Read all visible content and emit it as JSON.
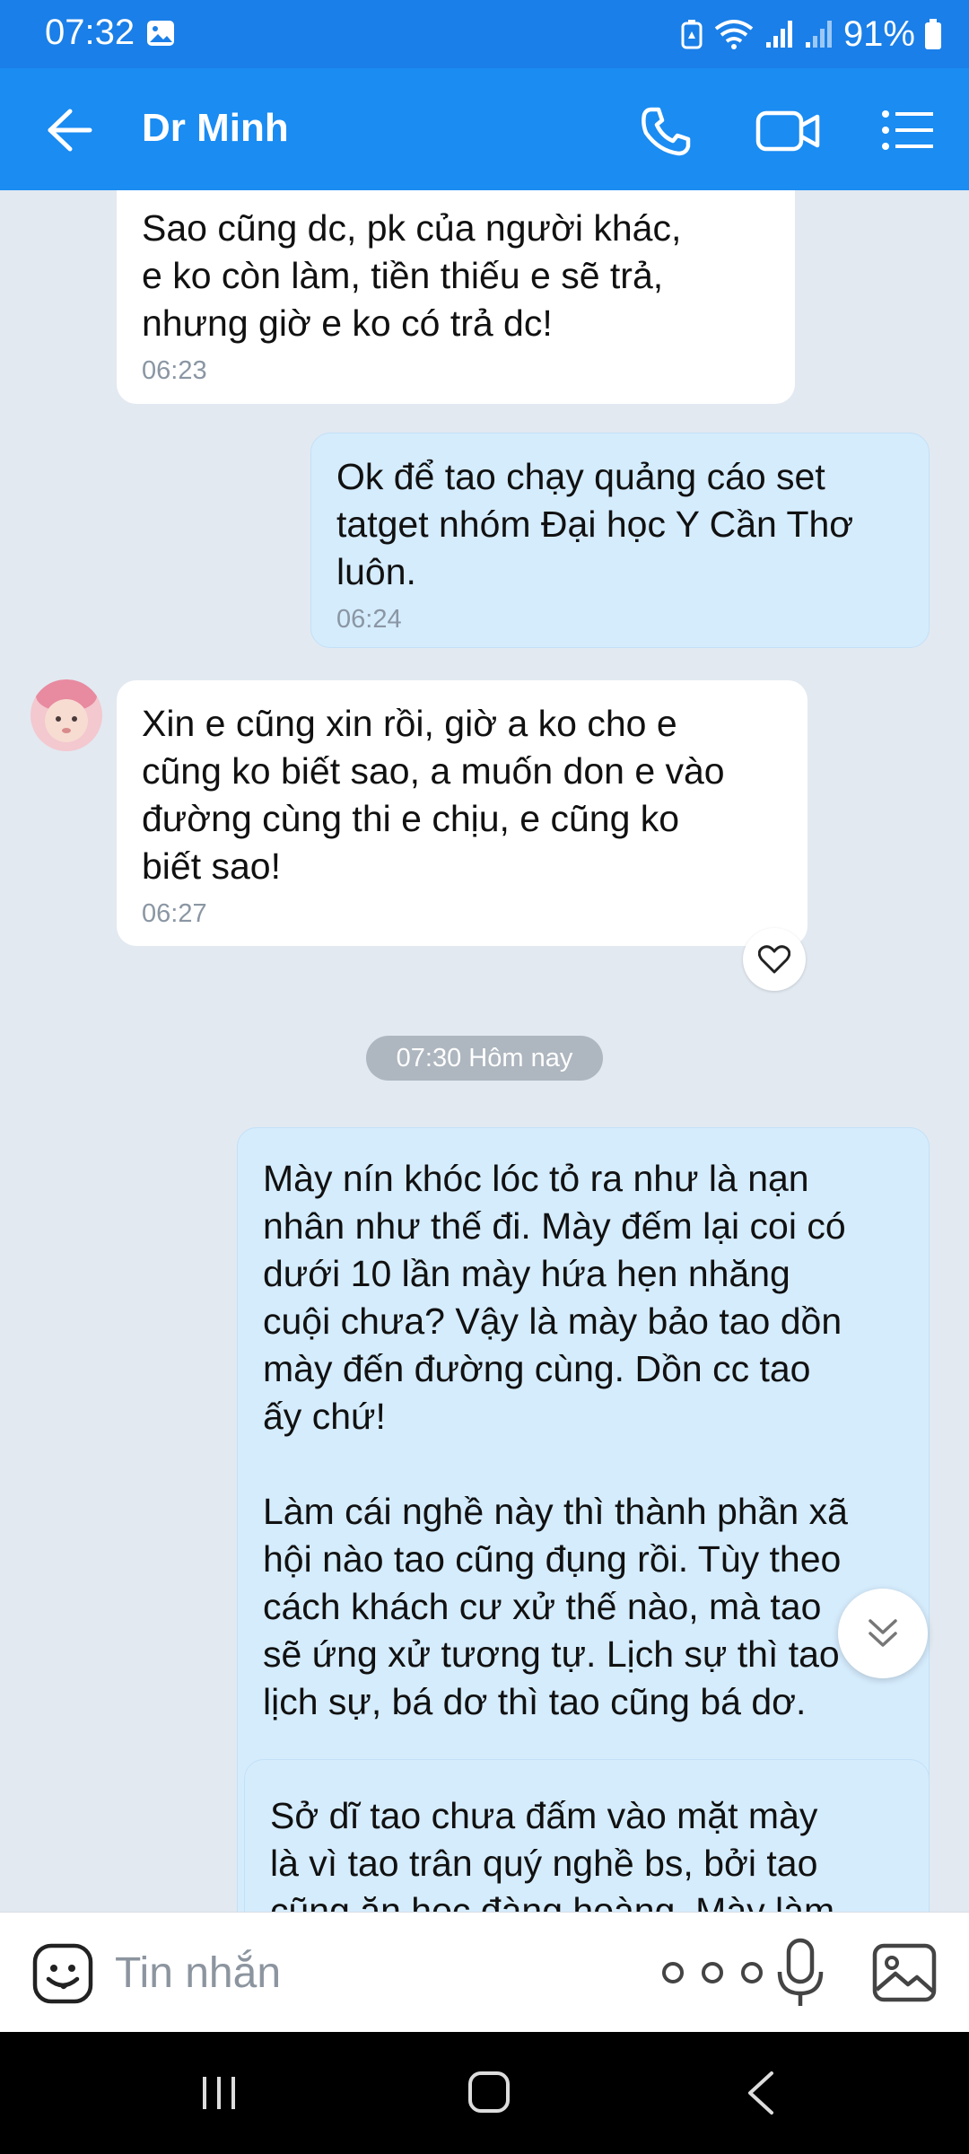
{
  "status_bar": {
    "time": "07:32",
    "battery": "91%",
    "icons": [
      "gallery-icon",
      "battery-saver-icon",
      "wifi-icon",
      "signal-icon",
      "signal-icon",
      "battery-icon"
    ]
  },
  "header": {
    "back_icon": "arrow-left-icon",
    "title": "Dr Minh",
    "actions": [
      "phone-icon",
      "video-call-icon",
      "list-menu-icon"
    ]
  },
  "messages": [
    {
      "direction": "in",
      "text": "Sao cũng dc, pk của người khác,\ne ko còn làm, tiền thiếu e sẽ trả,\nnhưng giờ e ko có trả dc!",
      "time": "06:23"
    },
    {
      "direction": "out",
      "text": "Ok để tao chạy quảng cáo set\ntatget nhóm Đại học Y Cần Thơ\nluôn.",
      "time": "06:24"
    },
    {
      "direction": "in",
      "text": "Xin e cũng xin rồi, giờ a ko cho e\ncũng ko biết sao, a muốn don e vào\nđường cùng thi e chịu, e cũng ko\nbiết sao!",
      "time": "06:27"
    },
    {
      "direction": "out",
      "text": "Mày nín khóc lóc tỏ ra như là nạn\nnhân như thế đi. Mày đếm lại coi có\ndưới 10 lần mày hứa hẹn nhăng\ncuội chưa? Vậy là mày bảo tao dồn\nmày đến đường cùng. Dồn cc tao\nấy chứ!\n\nLàm cái nghề này thì thành phần xã\nhội nào tao cũng đụng rồi. Tùy theo\ncách khách cư xử thế nào, mà tao\nsẽ ứng xử tương tự. Lịch sự thì tao\nlịch sự, bá dơ thì tao cũng bá dơ."
    },
    {
      "direction": "out",
      "text": "Sở dĩ tao chưa đấm vào mặt mày\nlà vì tao trân quý nghề bs, bởi tao\ncũng ăn học đàng hoàng. Mày làm"
    }
  ],
  "date_separator": "07:30 Hôm nay",
  "input": {
    "placeholder": "Tin nhắn",
    "icons": [
      "sticker-icon",
      "more-icon",
      "microphone-icon",
      "image-icon"
    ]
  },
  "colors": {
    "header": "#1a8cf2",
    "status_bar": "#1a7fe8",
    "chat_background": "#e2e9f1",
    "incoming_bubble": "#ffffff",
    "outgoing_bubble": "#d5ecfd"
  }
}
